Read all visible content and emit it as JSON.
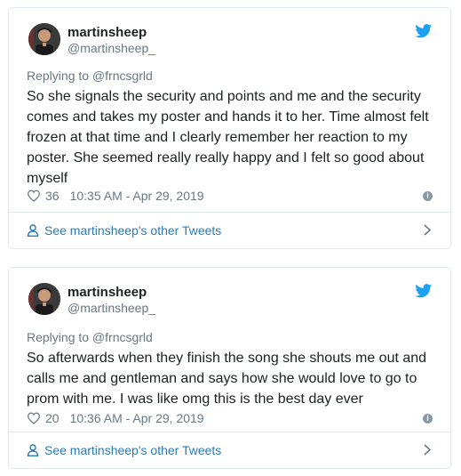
{
  "tweets": [
    {
      "name": "martinsheep",
      "handle": "@martinsheep_",
      "replying_to": "Replying to @frncsgrld",
      "text": "So she signals the security and points and me and the security comes and takes my poster and hands it to her. Time almost felt frozen at that time and I clearly remember her reaction to my poster. She seemed really really happy and I felt so good about myself",
      "likes": "36",
      "timestamp": "10:35 AM - Apr 29, 2019",
      "footer_link": "See martinsheep's other Tweets"
    },
    {
      "name": "martinsheep",
      "handle": "@martinsheep_",
      "replying_to": "Replying to @frncsgrld",
      "text": "So afterwards when they finish the song she shouts me out and calls me and gentleman and says how she would love to go to prom with me. I was like omg this is the best day ever",
      "likes": "20",
      "timestamp": "10:36 AM - Apr 29, 2019",
      "footer_link": "See martinsheep's other Tweets"
    }
  ],
  "icons": {
    "brand": "twitter-bird-icon",
    "like": "heart-icon",
    "info": "info-icon",
    "person": "person-icon",
    "chevron": "chevron-right-icon"
  },
  "colors": {
    "twitter_blue": "#1da1f2",
    "link_blue": "#2b7bb9",
    "secondary_text": "#697882",
    "border": "#e1e8ed"
  }
}
